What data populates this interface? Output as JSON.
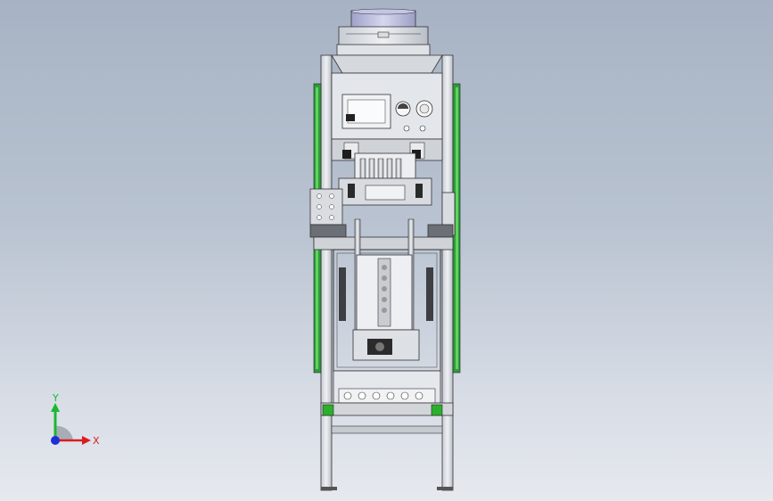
{
  "viewport": {
    "background_top": "#a7b3c4",
    "background_bottom": "#e6e9ee",
    "content": "cad-model-front-view"
  },
  "triad": {
    "y_label": "Y",
    "x_label": "X",
    "y_color": "#19b832",
    "x_color": "#d81e1e",
    "z_color": "#1f2fd6"
  },
  "model": {
    "frame_color": "#8a9098",
    "accent_green": "#3cc43c",
    "wheel_green": "#1ba81b"
  }
}
